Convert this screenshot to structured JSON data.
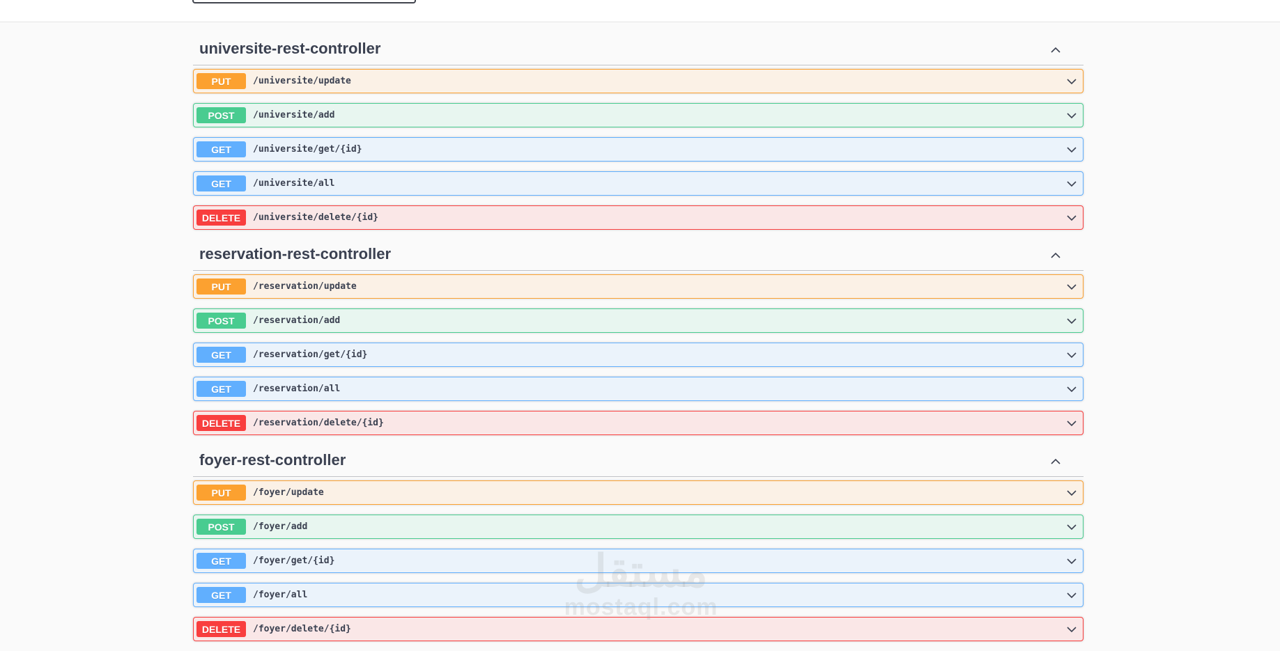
{
  "sections": [
    {
      "title": "universite-rest-controller",
      "operations": [
        {
          "method": "PUT",
          "path": "/universite/update",
          "kind": "put"
        },
        {
          "method": "POST",
          "path": "/universite/add",
          "kind": "post"
        },
        {
          "method": "GET",
          "path": "/universite/get/{id}",
          "kind": "get"
        },
        {
          "method": "GET",
          "path": "/universite/all",
          "kind": "get"
        },
        {
          "method": "DELETE",
          "path": "/universite/delete/{id}",
          "kind": "delete"
        }
      ]
    },
    {
      "title": "reservation-rest-controller",
      "operations": [
        {
          "method": "PUT",
          "path": "/reservation/update",
          "kind": "put"
        },
        {
          "method": "POST",
          "path": "/reservation/add",
          "kind": "post"
        },
        {
          "method": "GET",
          "path": "/reservation/get/{id}",
          "kind": "get"
        },
        {
          "method": "GET",
          "path": "/reservation/all",
          "kind": "get"
        },
        {
          "method": "DELETE",
          "path": "/reservation/delete/{id}",
          "kind": "delete"
        }
      ]
    },
    {
      "title": "foyer-rest-controller",
      "operations": [
        {
          "method": "PUT",
          "path": "/foyer/update",
          "kind": "put"
        },
        {
          "method": "POST",
          "path": "/foyer/add",
          "kind": "post"
        },
        {
          "method": "GET",
          "path": "/foyer/get/{id}",
          "kind": "get"
        },
        {
          "method": "GET",
          "path": "/foyer/all",
          "kind": "get"
        },
        {
          "method": "DELETE",
          "path": "/foyer/delete/{id}",
          "kind": "delete"
        }
      ]
    }
  ],
  "icons": {
    "section_toggle": "chevron-up-icon",
    "operation_toggle": "chevron-down-icon"
  },
  "colors": {
    "put": "#fca130",
    "post": "#49cc90",
    "get": "#61affe",
    "delete": "#f93e3e"
  },
  "watermark": {
    "arabic": "مستقل",
    "latin": "mostaql.com"
  }
}
